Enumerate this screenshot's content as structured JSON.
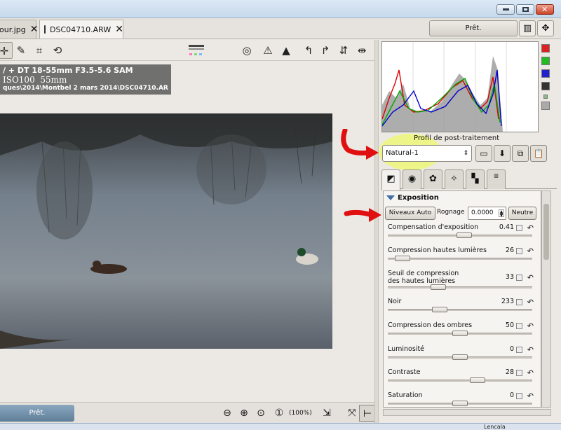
{
  "tabs": [
    {
      "label": "our.jpg",
      "active": false
    },
    {
      "label": "DSC04710.ARW",
      "active": true
    }
  ],
  "queue_button": "Prêt.",
  "exif": {
    "line1": "/ + DT 18-55mm F3.5-5.6 SAM",
    "line2_iso": "ISO100",
    "line2_focal": "55mm",
    "line3": "ques\\2014\\Montbel 2 mars 2014\\DSC04710.ARW"
  },
  "bottom": {
    "progress_label": "Prêt.",
    "zoom_level": "(100%)"
  },
  "processing": {
    "label": "Profil de post-traitement",
    "profile_value": "Natural-1"
  },
  "exposure": {
    "header": "Exposition",
    "auto_levels": "Niveaux Auto",
    "clip_label": "Rognage",
    "clip_value": "0.0000",
    "neutral": "Neutre",
    "sliders": [
      {
        "label": "Compensation d'exposition",
        "value": "0.41",
        "fraction": 0.53
      },
      {
        "label": "Compression hautes lumières",
        "value": "26",
        "fraction": 0.1
      },
      {
        "label": "Seuil de compression\ndes hautes lumières",
        "value": "33",
        "fraction": 0.35
      },
      {
        "label": "Noir",
        "value": "233",
        "fraction": 0.36
      },
      {
        "label": "Compression des ombres",
        "value": "50",
        "fraction": 0.5
      },
      {
        "label": "Luminosité",
        "value": "0",
        "fraction": 0.5
      },
      {
        "label": "Contraste",
        "value": "28",
        "fraction": 0.62
      },
      {
        "label": "Saturation",
        "value": "0",
        "fraction": 0.5
      }
    ]
  },
  "taskbar_text": "Lencala"
}
